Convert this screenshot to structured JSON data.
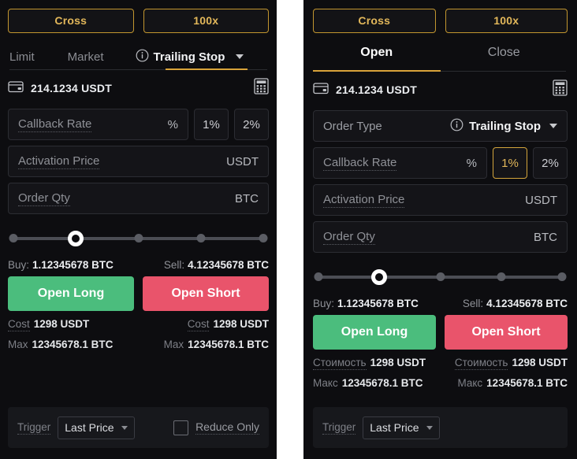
{
  "colors": {
    "panel_bg": "#0d0d10",
    "gap_bg": "#ffffff",
    "accent_gold": "#d3a53c",
    "gold_text": "#e2b75a",
    "long_green": "#4bbd7d",
    "short_red": "#e9546b",
    "field_bg": "#141418",
    "field_border": "#2c2d33"
  },
  "left_panel": {
    "margin_mode_button": "Cross",
    "leverage_button": "100x",
    "tabs": [
      {
        "label": "Limit",
        "active": false
      },
      {
        "label": "Market",
        "active": false
      },
      {
        "label": "Trailing Stop",
        "active": true,
        "has_info_icon": true,
        "has_caret": true
      }
    ],
    "wallet": {
      "icon": "wallet-icon",
      "balance": "214.1234 USDT",
      "calculator_icon": "calculator-icon"
    },
    "callback_rate": {
      "placeholder": "Callback Rate",
      "unit": "%",
      "presets": [
        {
          "label": "1%",
          "selected": false
        },
        {
          "label": "2%",
          "selected": false
        }
      ]
    },
    "activation_price": {
      "placeholder": "Activation Price",
      "unit": "USDT"
    },
    "order_qty": {
      "placeholder": "Order Qty",
      "unit": "BTC"
    },
    "slider": {
      "ticks": [
        0,
        25,
        50,
        75,
        100
      ],
      "handle": 25
    },
    "buy": {
      "label": "Buy:",
      "value": "1.12345678 BTC"
    },
    "sell": {
      "label": "Sell:",
      "value": "4.12345678 BTC"
    },
    "open_long_button": "Open Long",
    "open_short_button": "Open Short",
    "long_info": {
      "cost_label": "Cost",
      "cost_value": "1298 USDT",
      "max_label": "Max",
      "max_value": "12345678.1 BTC"
    },
    "short_info": {
      "cost_label": "Cost",
      "cost_value": "1298 USDT",
      "max_label": "Max",
      "max_value": "12345678.1 BTC"
    },
    "trigger": {
      "label": "Trigger",
      "selected": "Last Price"
    },
    "reduce_only": {
      "label": "Reduce Only",
      "checked": false
    }
  },
  "right_panel": {
    "margin_mode_button": "Cross",
    "leverage_button": "100x",
    "tabs": [
      {
        "label": "Open",
        "active": true
      },
      {
        "label": "Close",
        "active": false
      }
    ],
    "wallet": {
      "icon": "wallet-icon",
      "balance": "214.1234 USDT",
      "calculator_icon": "calculator-icon"
    },
    "order_type": {
      "label": "Order Type",
      "value": "Trailing Stop",
      "has_info_icon": true,
      "has_caret": true
    },
    "callback_rate": {
      "placeholder": "Callback Rate",
      "unit": "%",
      "presets": [
        {
          "label": "1%",
          "selected": true
        },
        {
          "label": "2%",
          "selected": false
        }
      ]
    },
    "activation_price": {
      "placeholder": "Activation Price",
      "unit": "USDT"
    },
    "order_qty": {
      "placeholder": "Order Qty",
      "unit": "BTC"
    },
    "slider": {
      "ticks": [
        0,
        25,
        50,
        75,
        100
      ],
      "handle": 25
    },
    "buy": {
      "label": "Buy:",
      "value": "1.12345678 BTC"
    },
    "sell": {
      "label": "Sell:",
      "value": "4.12345678 BTC"
    },
    "open_long_button": "Open Long",
    "open_short_button": "Open Short",
    "long_info": {
      "cost_label": "Стоимость",
      "cost_value": "1298 USDT",
      "max_label": "Макс",
      "max_value": "12345678.1 BTC"
    },
    "short_info": {
      "cost_label": "Стоимость",
      "cost_value": "1298 USDT",
      "max_label": "Макс",
      "max_value": "12345678.1 BTC"
    },
    "trigger": {
      "label": "Trigger",
      "selected": "Last Price"
    }
  }
}
